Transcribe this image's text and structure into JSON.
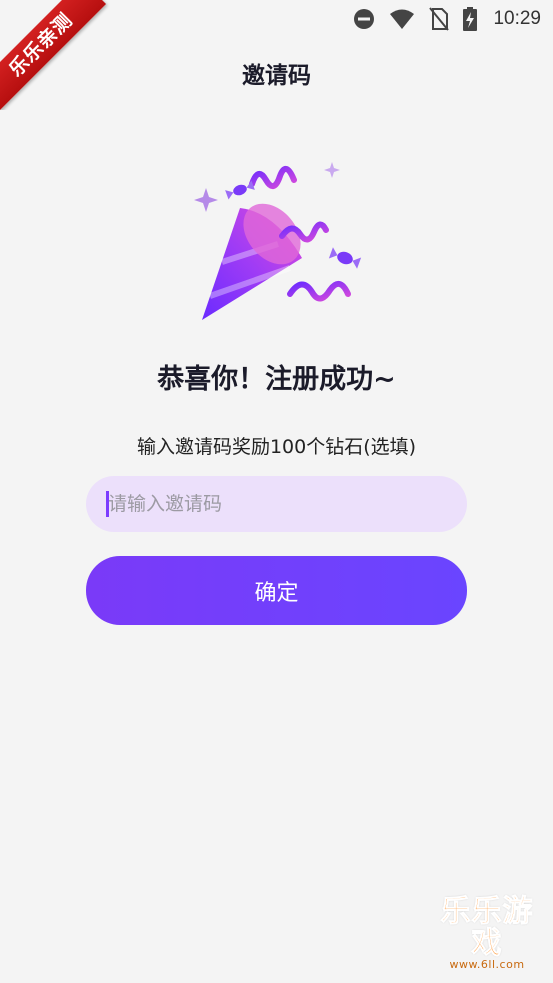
{
  "status_bar": {
    "time": "10:29",
    "icons": [
      "do-not-disturb-icon",
      "wifi-icon",
      "no-sim-icon",
      "battery-charging-icon"
    ]
  },
  "ribbon": {
    "label": "乐乐亲测"
  },
  "header": {
    "title": "邀请码"
  },
  "illustration": {
    "icon": "party-popper-icon"
  },
  "main": {
    "headline": "恭喜你！注册成功~",
    "subline": "输入邀请码奖励100个钻石(选填)",
    "invite_input": {
      "value": "",
      "placeholder": "请输入邀请码"
    },
    "confirm_label": "确定"
  },
  "watermark": {
    "title": "乐乐游戏",
    "url": "www.6ll.com"
  },
  "colors": {
    "accent": "#7a3af8",
    "input_bg": "#ece0fb",
    "ribbon": "#c81616",
    "watermark": "#ff8a1c"
  }
}
